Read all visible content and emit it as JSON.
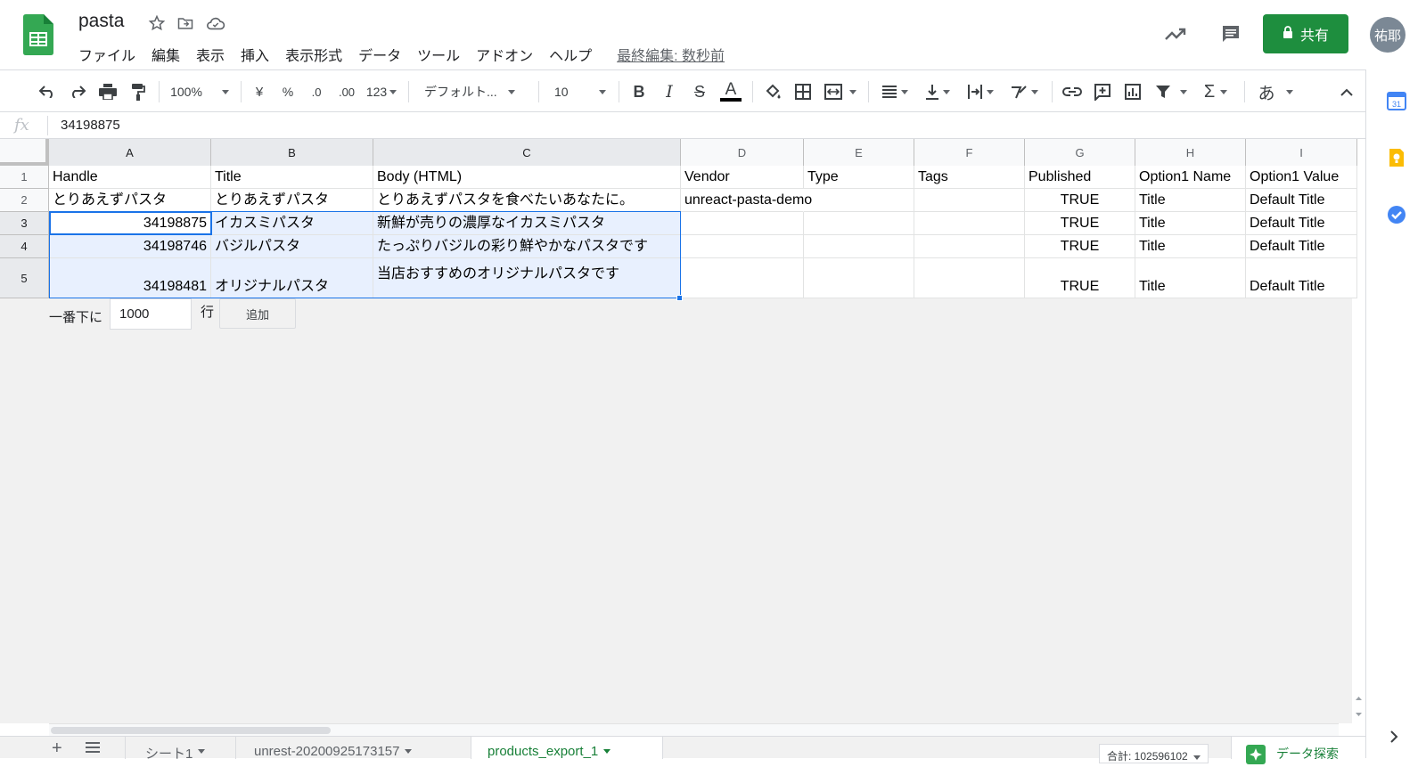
{
  "app": {
    "title": "pasta",
    "menu": [
      "ファイル",
      "編集",
      "表示",
      "挿入",
      "表示形式",
      "データ",
      "ツール",
      "アドオン",
      "ヘルプ"
    ],
    "last_edit": "最終編集: 数秒前",
    "share_label": "共有",
    "avatar_text": "祐耶",
    "brand_color": "#188038"
  },
  "toolbar": {
    "zoom": "100%",
    "currency": "¥",
    "percent": "%",
    "dec_decrease": ".0",
    "dec_increase": ".00",
    "more_formats": "123",
    "font": "デフォルト...",
    "font_size": "10",
    "input_tools": "あ"
  },
  "formula_bar": {
    "fx": "fx",
    "value": "34198875"
  },
  "sheet": {
    "columns": [
      "A",
      "B",
      "C",
      "D",
      "E",
      "F",
      "G",
      "H",
      "I"
    ],
    "row_numbers": [
      "1",
      "2",
      "3",
      "4",
      "5"
    ],
    "rows": [
      [
        "Handle",
        "Title",
        "Body (HTML)",
        "Vendor",
        "Type",
        "Tags",
        "Published",
        "Option1 Name",
        "Option1 Value"
      ],
      [
        "とりあえずパスタ",
        "とりあえずパスタ",
        "とりあえずパスタを食べたいあなたに。",
        "unreact-pasta-demo",
        "",
        "",
        "TRUE",
        "Title",
        "Default Title"
      ],
      [
        "34198875",
        "イカスミパスタ",
        "新鮮が売りの濃厚なイカスミパスタ",
        "",
        "",
        "",
        "TRUE",
        "Title",
        "Default Title"
      ],
      [
        "34198746",
        "バジルパスタ",
        "たっぷりバジルの彩り鮮やかなパスタです",
        "",
        "",
        "",
        "TRUE",
        "Title",
        "Default Title"
      ],
      [
        "34198481",
        "オリジナルパスタ",
        "当店おすすめのオリジナルパスタです",
        "",
        "",
        "",
        "TRUE",
        "Title",
        "Default Title"
      ]
    ],
    "add_rows": {
      "prefix": "一番下に",
      "value": "1000",
      "suffix": "行",
      "button": "追加"
    }
  },
  "sheet_tabs": {
    "tabs": [
      "シート1",
      "unrest-20200925173157",
      "products_export_1"
    ],
    "active_index": 2,
    "sum": "合計: 102596102",
    "explore": "データ探索"
  }
}
